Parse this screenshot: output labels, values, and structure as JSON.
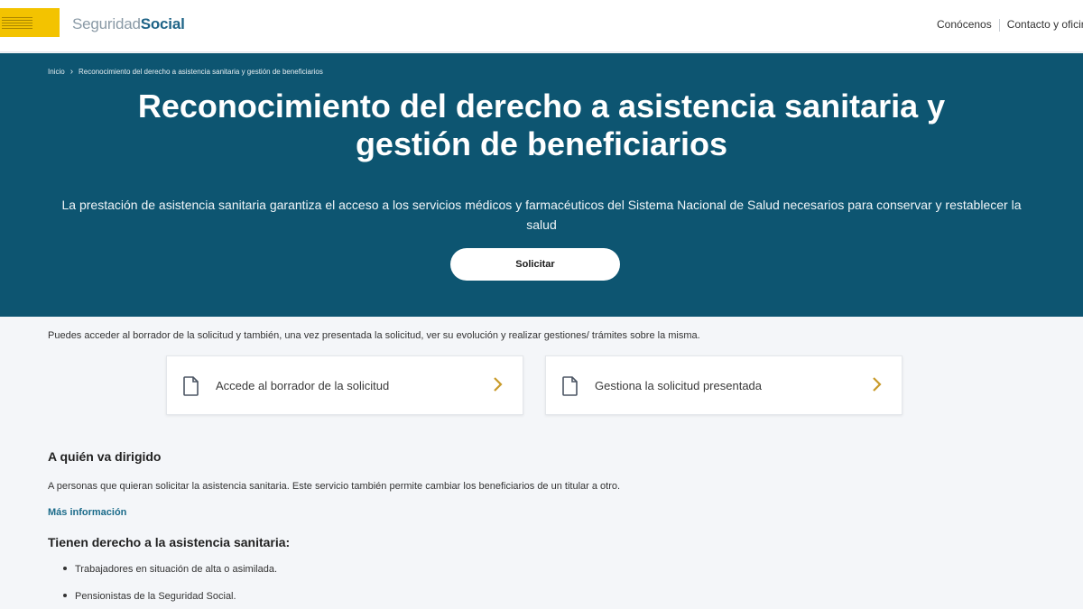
{
  "header": {
    "brand_light": "Seguridad",
    "brand_bold": "Social",
    "nav": [
      "Conócenos",
      "Contacto y oficir"
    ]
  },
  "breadcrumb": [
    "Inicio",
    "Reconocimiento del derecho a asistencia sanitaria y gestión de beneficiarios"
  ],
  "hero": {
    "title": "Reconocimiento del derecho a asistencia sanitaria y gestión de beneficiarios",
    "description": "La prestación de asistencia sanitaria garantiza el acceso a los servicios médicos y farmacéuticos del Sistema Nacional de Salud necesarios para conservar y restablecer la salud",
    "button": "Solicitar"
  },
  "intro": "Puedes acceder al borrador de la solicitud y también, una vez presentada la solicitud, ver su evolución y realizar gestiones/ trámites sobre la misma.",
  "cards": [
    {
      "label": "Accede al borrador de la solicitud",
      "icon": "document-icon"
    },
    {
      "label": "Gestiona la solicitud presentada",
      "icon": "document-icon"
    }
  ],
  "section1": {
    "title": "A quién va dirigido",
    "text": "A personas que quieran solicitar la asistencia sanitaria. Este servicio también permite cambiar los beneficiarios de un titular a otro.",
    "link": "Más información"
  },
  "section2": {
    "title": "Tienen derecho a la asistencia sanitaria:",
    "items": [
      "Trabajadores en situación de alta o asimilada.",
      "Pensionistas de la Seguridad Social."
    ]
  },
  "colors": {
    "hero": "#0d5571",
    "accent": "#c89a2a",
    "link": "#1b6b8a",
    "logo": "#f3c300"
  }
}
